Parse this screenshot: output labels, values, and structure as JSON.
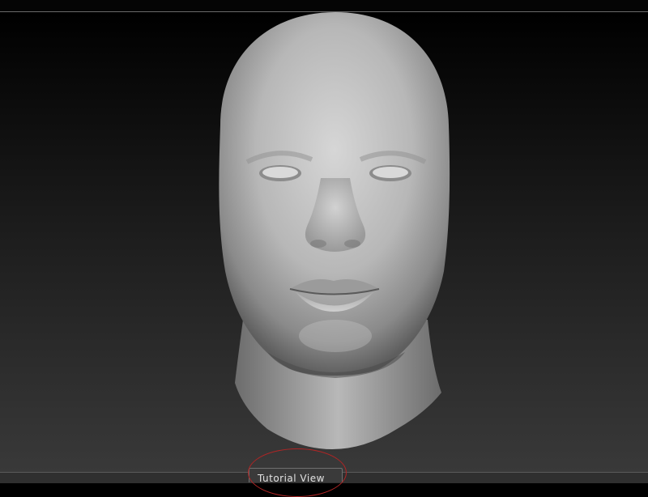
{
  "footer": {
    "tutorial_view_label": "Tutorial View"
  },
  "icons": {
    "highlight": "red-circle-annotation"
  },
  "colors": {
    "highlight": "#b02525",
    "viewport_top": "#000000",
    "viewport_bottom": "#393939"
  }
}
